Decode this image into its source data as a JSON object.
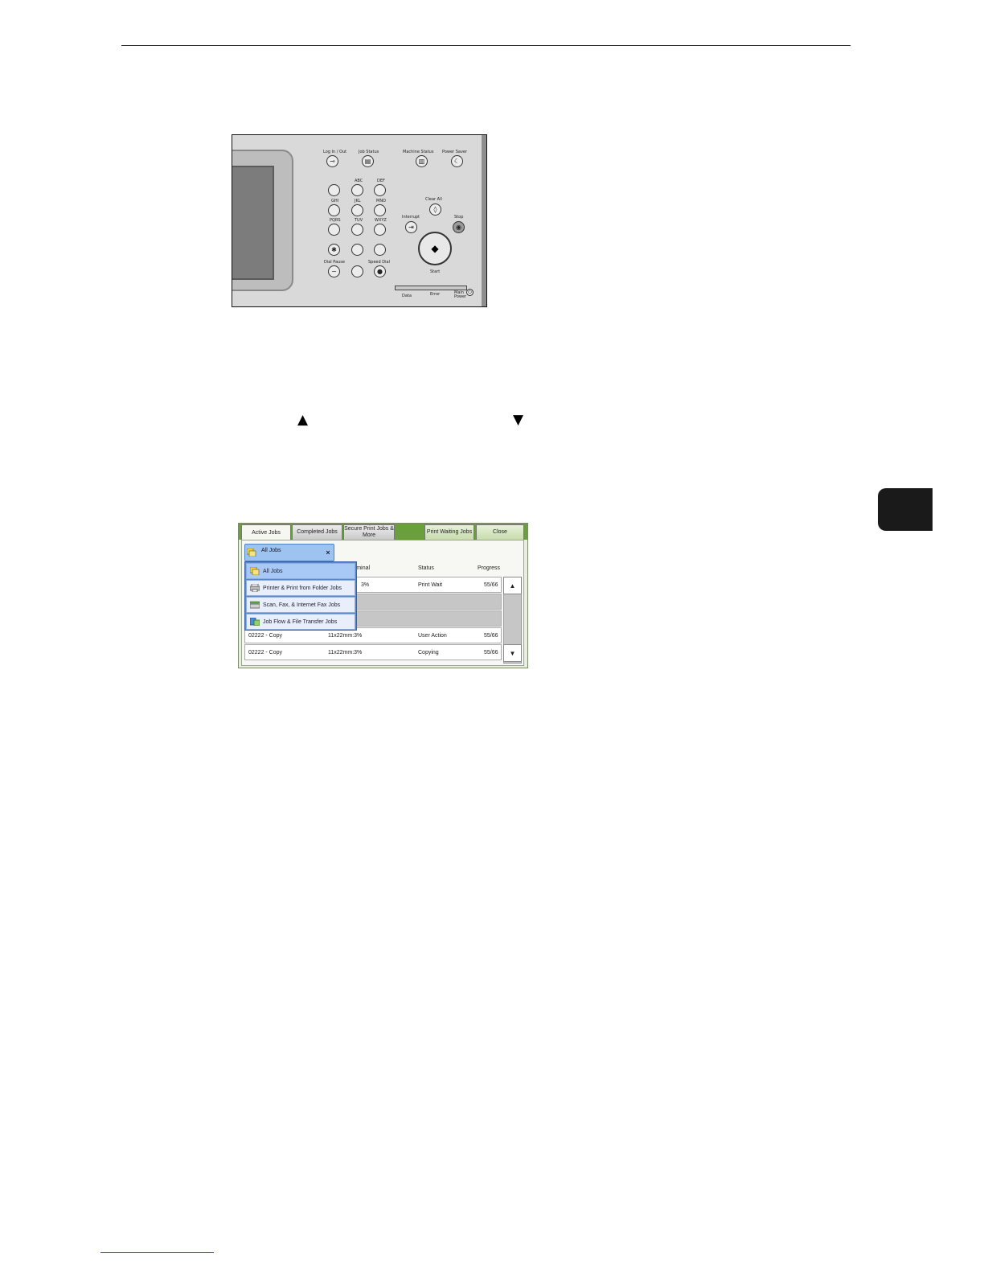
{
  "page": {
    "arrow_up_glyph": "▲",
    "arrow_down_glyph": "▼"
  },
  "control_panel": {
    "log_in_out": "Log In / Out",
    "job_status": "Job Status",
    "machine_status": "Machine Status",
    "power_saver": "Power Saver",
    "clear_all": "Clear All",
    "interrupt": "Interrupt",
    "stop": "Stop",
    "start": "Start",
    "dial_pause": "Dial Pause",
    "speed_dial": "Speed Dial",
    "data": "Data",
    "error": "Error",
    "main_power": "Main Power",
    "key_labels": [
      "ABC",
      "DEF",
      "GHI",
      "JKL",
      "MNO",
      "PQRS",
      "TUV",
      "WXYZ"
    ]
  },
  "job_screen": {
    "tabs": {
      "active_jobs": "Active Jobs",
      "completed_jobs": "Completed Jobs",
      "secure_print": "Secure Print Jobs & More",
      "print_waiting": "Print Waiting Jobs",
      "close": "Close"
    },
    "columns": {
      "terminal": "rminal",
      "status": "Status",
      "progress": "Progress"
    },
    "dropdown": {
      "selected": "All Jobs",
      "close_glyph": "×",
      "options": [
        "All Jobs",
        "Printer & Print from Folder Jobs",
        "Scan, Fax, & Internet Fax Jobs",
        "Job Flow & File Transfer Jobs"
      ]
    },
    "rows": [
      {
        "name": "",
        "terminal": "3%",
        "status": "Print Wait",
        "progress": "55/66"
      },
      {
        "name": "02222 - Copy",
        "terminal": "11x22mm:3%",
        "status": "User Action",
        "progress": "55/66"
      },
      {
        "name": "02222 - Copy",
        "terminal": "11x22mm:3%",
        "status": "Copying",
        "progress": "55/66"
      }
    ],
    "scroll_up_glyph": "▲",
    "scroll_down_glyph": "▼"
  },
  "colors": {
    "tab_bar_green": "#6aa03b",
    "dropdown_blue": "#5b87c8",
    "chapter_tab": "#1a1a1a"
  }
}
